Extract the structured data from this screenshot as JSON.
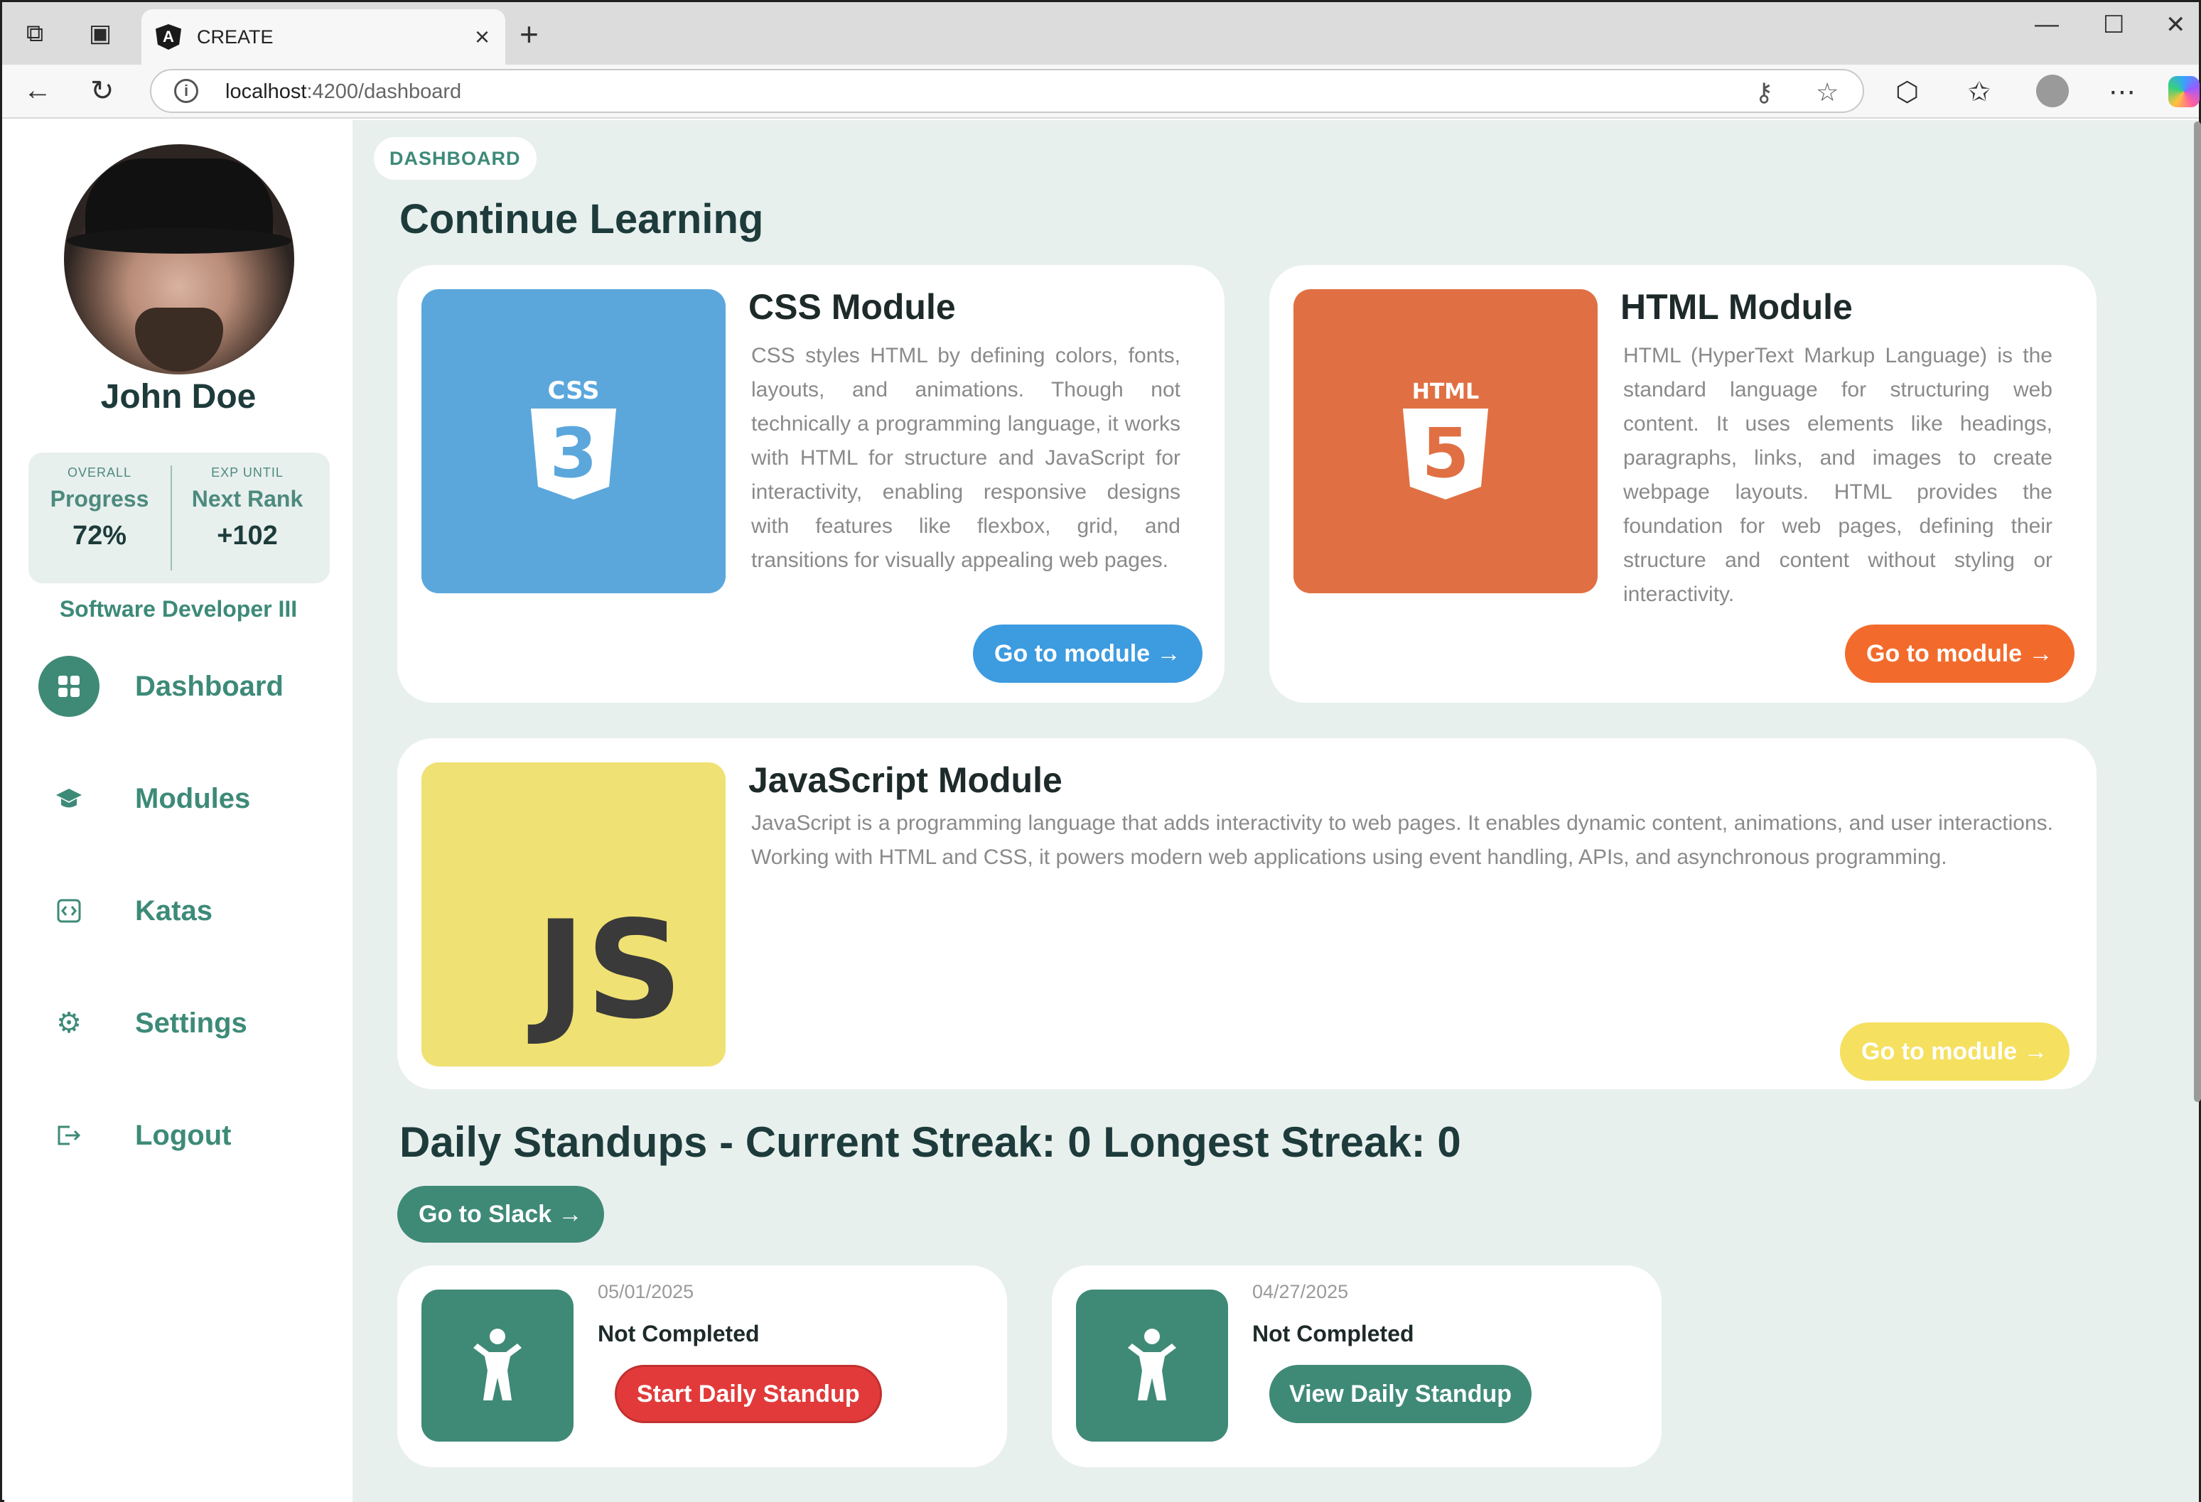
{
  "browser": {
    "tab_title": "CREATE",
    "tab_favicon": "A",
    "url_host": "localhost",
    "url_rest": ":4200/dashboard"
  },
  "profile": {
    "name": "John Doe",
    "progress_caption": "OVERALL",
    "progress_label": "Progress",
    "progress_value": "72%",
    "rank_caption": "EXP UNTIL",
    "rank_label": "Next Rank",
    "rank_value": "+102",
    "role": "Software Developer III"
  },
  "nav": {
    "items": [
      {
        "label": "Dashboard",
        "icon": "grid-icon",
        "active": true
      },
      {
        "label": "Modules",
        "icon": "graduation-cap-icon"
      },
      {
        "label": "Katas",
        "icon": "code-icon"
      },
      {
        "label": "Settings",
        "icon": "gear-icon"
      },
      {
        "label": "Logout",
        "icon": "logout-icon"
      }
    ]
  },
  "page": {
    "chip": "DASHBOARD",
    "heading": "Continue Learning"
  },
  "modules": [
    {
      "title": "CSS Module",
      "badge": "CSS",
      "badge_number": "3",
      "color": "#5ba7dc",
      "button_color": "#3d9be0",
      "description": "CSS styles HTML by defining colors, fonts, layouts, and animations. Though not technically a programming language, it works with HTML for structure and JavaScript for interactivity, enabling responsive designs with features like flexbox, grid, and transitions for visually appealing web pages.",
      "button": "Go to module →"
    },
    {
      "title": "HTML Module",
      "badge": "HTML",
      "badge_number": "5",
      "color": "#e07043",
      "button_color": "#f26b2c",
      "description": "HTML (HyperText Markup Language) is the standard language for structuring web content. It uses elements like headings, paragraphs, links, and images to create webpage layouts. HTML provides the foundation for web pages, defining their structure and content without styling or interactivity.",
      "button": "Go to module →"
    },
    {
      "title": "JavaScript Module",
      "badge": "JS",
      "color": "#f0e174",
      "button_color": "#f5e060",
      "description": "JavaScript is a programming language that adds interactivity to web pages. It enables dynamic content, animations, and user interactions. Working with HTML and CSS, it powers modern web applications using event handling, APIs, and asynchronous programming.",
      "button": "Go to module →"
    }
  ],
  "standups": {
    "heading": "Daily Standups - Current Streak: 0 Longest Streak: 0",
    "slack_button": "Go to Slack →",
    "items": [
      {
        "date": "05/01/2025",
        "status": "Not Completed",
        "button": "Start Daily Standup",
        "button_color": "#e23a3a"
      },
      {
        "date": "04/27/2025",
        "status": "Not Completed",
        "button": "View Daily Standup",
        "button_color": "#3f8a77"
      }
    ]
  },
  "colors": {
    "accent": "#3f8a77",
    "background": "#e8f0ee",
    "heading": "#1e3b3b"
  }
}
